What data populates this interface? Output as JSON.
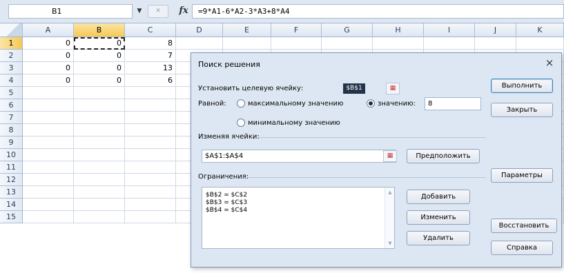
{
  "formula_bar": {
    "name_box": "B1",
    "formula": "=9*A1-6*A2-3*A3+8*A4",
    "fx_label": "fx"
  },
  "columns": [
    "A",
    "B",
    "C",
    "D",
    "E",
    "F",
    "G",
    "H",
    "I",
    "J",
    "K"
  ],
  "rows": [
    {
      "num": "1",
      "A": "0",
      "B": "0",
      "C": "8"
    },
    {
      "num": "2",
      "A": "0",
      "B": "0",
      "C": "7"
    },
    {
      "num": "3",
      "A": "0",
      "B": "0",
      "C": "13"
    },
    {
      "num": "4",
      "A": "0",
      "B": "0",
      "C": "6"
    },
    {
      "num": "5"
    },
    {
      "num": "6"
    },
    {
      "num": "7"
    },
    {
      "num": "8"
    },
    {
      "num": "9"
    },
    {
      "num": "10"
    },
    {
      "num": "11"
    },
    {
      "num": "12"
    },
    {
      "num": "13"
    },
    {
      "num": "14"
    },
    {
      "num": "15"
    }
  ],
  "dialog": {
    "title": "Поиск решения",
    "close": "×",
    "target_label": "Установить целевую ячейку:",
    "target_value": "$B$1",
    "equal_label": "Равной:",
    "opt_max": "максимальному значению",
    "opt_value": "значению:",
    "value_input": "8",
    "opt_min": "минимальному значению",
    "changing_label": "Изменяя ячейки:",
    "changing_value": "$A$1:$A$4",
    "guess_button": "Предположить",
    "constraints_label": "Ограничения:",
    "constraints": [
      "$B$2 = $C$2",
      "$B$3 = $C$3",
      "$B$4 = $C$4"
    ],
    "add_button": "Добавить",
    "change_button": "Изменить",
    "delete_button": "Удалить",
    "run_button": "Выполнить",
    "close_button": "Закрыть",
    "params_button": "Параметры",
    "restore_button": "Восстановить",
    "help_button": "Справка"
  }
}
